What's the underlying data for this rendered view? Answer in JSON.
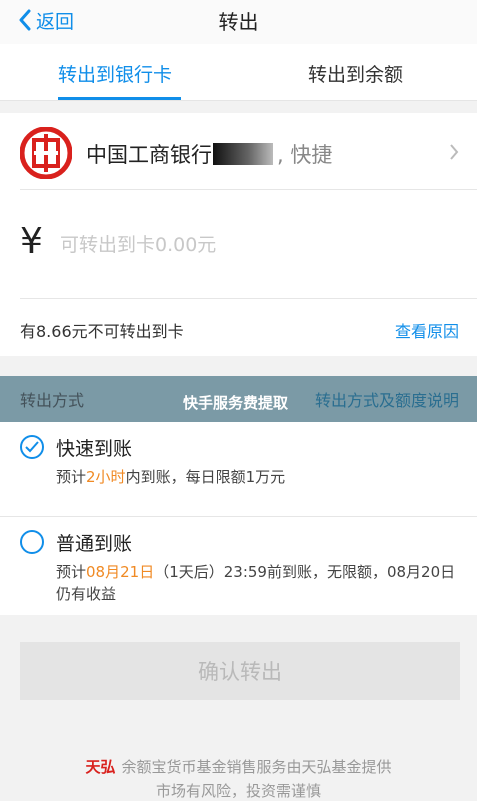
{
  "nav": {
    "back_label": "返回",
    "title": "转出"
  },
  "tabs": [
    {
      "label": "转出到银行卡",
      "active": true
    },
    {
      "label": "转出到余额",
      "active": false
    }
  ],
  "bank": {
    "name": "中国工商银行",
    "suffix": ", 快捷",
    "logo_color": "#d9211d"
  },
  "amount": {
    "currency_symbol": "¥",
    "placeholder": "可转出到卡0.00元"
  },
  "limit": {
    "text": "有8.66元不可转出到卡",
    "reason_link": "查看原因"
  },
  "method_header": {
    "label": "转出方式",
    "link": "转出方式及额度说明",
    "overlay_text": "快手服务费提取"
  },
  "options": [
    {
      "title": "快速到账",
      "desc_prefix": "预计",
      "desc_highlight": "2小时",
      "desc_suffix": "内到账，每日限额1万元",
      "selected": true
    },
    {
      "title": "普通到账",
      "desc_prefix": "预计",
      "desc_highlight": "08月21日",
      "desc_suffix": "（1天后）23:59前到账，无限额，08月20日仍有收益",
      "selected": false
    }
  ],
  "confirm_label": "确认转出",
  "footer": {
    "logo_text": "天弘",
    "line1": "余额宝货币基金销售服务由天弘基金提供",
    "line2": "市场有风险，投资需谨慎"
  },
  "colors": {
    "accent": "#108ee9",
    "highlight": "#f08a24"
  }
}
